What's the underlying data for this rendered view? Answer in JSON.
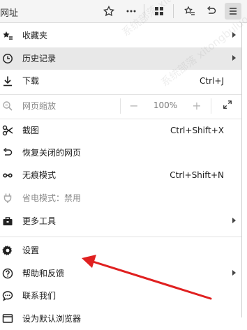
{
  "toolbar": {
    "address_fragment": "网址"
  },
  "menu": {
    "items": [
      {
        "label": "收藏夹",
        "shortcut": "",
        "submenu": true
      },
      {
        "label": "历史记录",
        "shortcut": "",
        "submenu": true
      },
      {
        "label": "下载",
        "shortcut": "Ctrl+J",
        "submenu": false
      },
      {
        "label": "网页缩放",
        "zoom_value": "100%",
        "disabled": true
      },
      {
        "label": "截图",
        "shortcut": "Ctrl+Shift+X",
        "submenu": false
      },
      {
        "label": "恢复关闭的网页",
        "shortcut": "",
        "submenu": false
      },
      {
        "label": "无痕模式",
        "shortcut": "Ctrl+Shift+N",
        "submenu": false
      },
      {
        "label": "省电模式：禁用",
        "shortcut": "",
        "disabled": true
      },
      {
        "label": "更多工具",
        "shortcut": "",
        "submenu": true
      },
      {
        "label": "设置",
        "shortcut": "",
        "submenu": false
      },
      {
        "label": "帮助和反馈",
        "shortcut": "",
        "submenu": true
      },
      {
        "label": "联系我们",
        "shortcut": "",
        "submenu": false
      },
      {
        "label": "设为默认浏览器",
        "shortcut": "",
        "submenu": false
      }
    ],
    "hovered_item": "历史记录"
  },
  "watermark": {
    "line1": "系统部落 xitongbuluo.com",
    "line2": "系统部落 xitongbuluo.com"
  },
  "colors": {
    "annotation_arrow": "#e02020",
    "hover_bg": "#e8e8e8"
  }
}
